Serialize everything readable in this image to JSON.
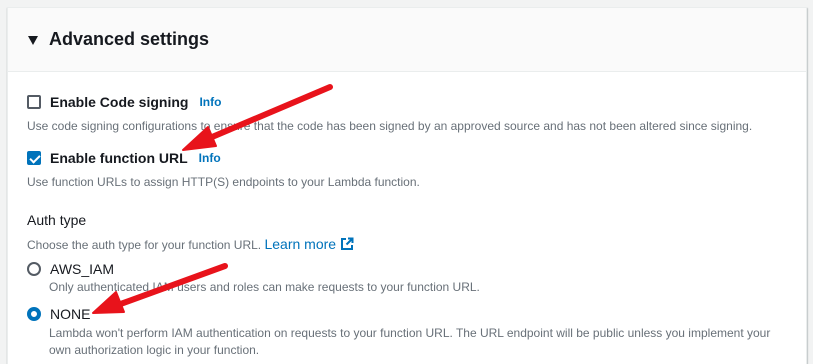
{
  "panel": {
    "title": "Advanced settings"
  },
  "code_signing": {
    "label": "Enable Code signing",
    "info": "Info",
    "checked": false,
    "description": "Use code signing configurations to ensure that the code has been signed by an approved source and has not been altered since signing."
  },
  "function_url": {
    "label": "Enable function URL",
    "info": "Info",
    "checked": true,
    "description": "Use function URLs to assign HTTP(S) endpoints to your Lambda function."
  },
  "auth_type": {
    "label": "Auth type",
    "description": "Choose the auth type for your function URL.",
    "learn_more": "Learn more",
    "options": [
      {
        "label": "AWS_IAM",
        "selected": false,
        "description": "Only authenticated IAM users and roles can make requests to your function URL."
      },
      {
        "label": "NONE",
        "selected": true,
        "description": "Lambda won't perform IAM authentication on requests to your function URL. The URL endpoint will be public unless you implement your own authorization logic in your function."
      }
    ]
  },
  "colors": {
    "accent": "#0073bb",
    "annotation_arrow": "#e8131b"
  }
}
